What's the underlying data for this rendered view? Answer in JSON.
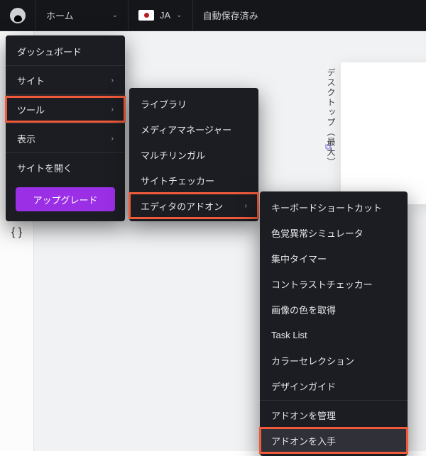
{
  "topbar": {
    "home_label": "ホーム",
    "lang_code": "JA",
    "autosave_label": "自動保存済み"
  },
  "viewport": {
    "vertical_label": "デスクトップ（最大）"
  },
  "gutter": {
    "braces": "{ }"
  },
  "menu1": {
    "items": [
      {
        "label": "ダッシュボード",
        "caret": false
      },
      {
        "label": "サイト",
        "caret": true
      },
      {
        "label": "ツール",
        "caret": true
      },
      {
        "label": "表示",
        "caret": true
      },
      {
        "label": "サイトを開く",
        "caret": false
      }
    ],
    "upgrade_label": "アップグレード"
  },
  "menu2": {
    "items": [
      {
        "label": "ライブラリ",
        "caret": false
      },
      {
        "label": "メディアマネージャー",
        "caret": false
      },
      {
        "label": "マルチリンガル",
        "caret": false
      },
      {
        "label": "サイトチェッカー",
        "caret": false
      },
      {
        "label": "エディタのアドオン",
        "caret": true
      }
    ]
  },
  "menu3": {
    "items": [
      {
        "label": "キーボードショートカット"
      },
      {
        "label": "色覚異常シミュレータ"
      },
      {
        "label": "集中タイマー"
      },
      {
        "label": "コントラストチェッカー"
      },
      {
        "label": "画像の色を取得"
      },
      {
        "label": "Task List"
      },
      {
        "label": "カラーセレクション"
      },
      {
        "label": "デザインガイド"
      },
      {
        "label": "アドオンを管理"
      },
      {
        "label": "アドオンを入手"
      }
    ]
  }
}
